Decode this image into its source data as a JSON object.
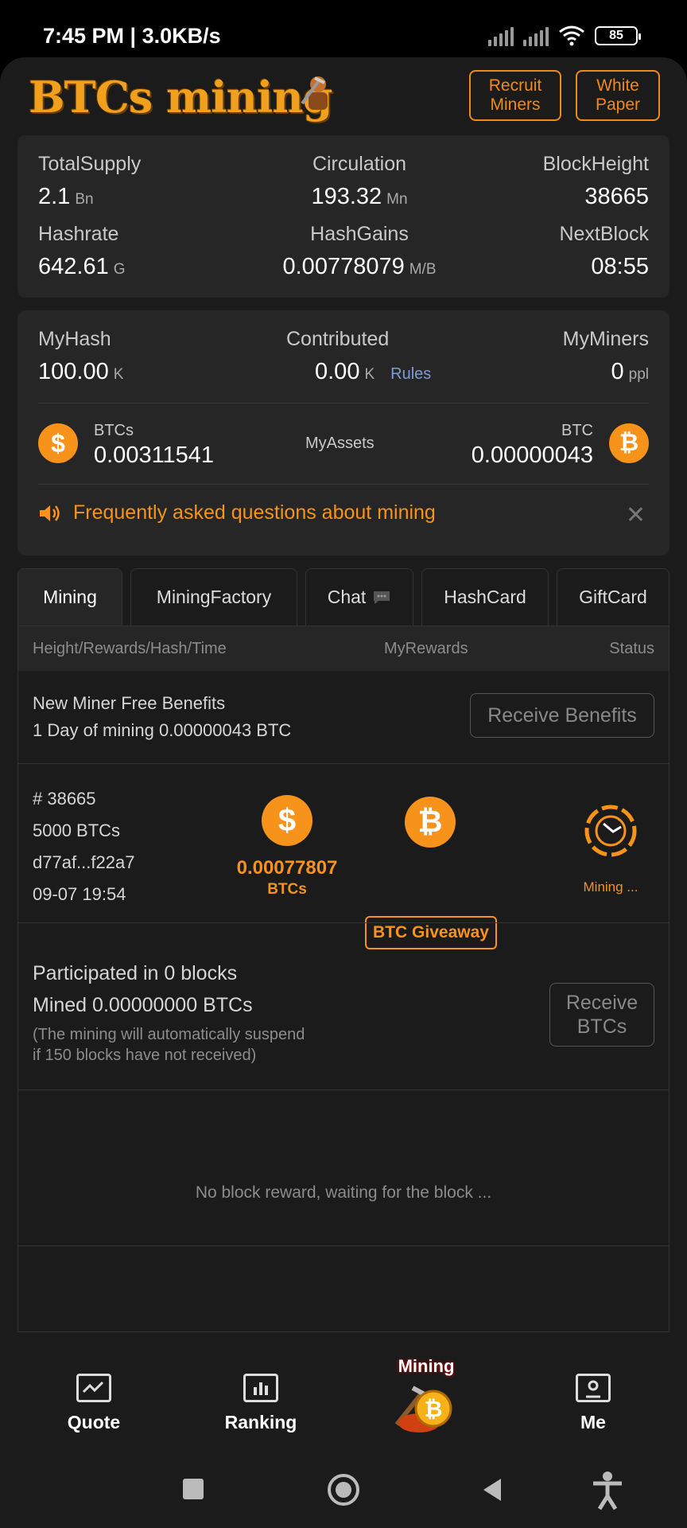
{
  "status": {
    "time": "7:45 PM | 3.0KB/s",
    "battery": "85"
  },
  "header": {
    "logo": "BTCs mining",
    "recruit": "Recruit Miners",
    "paper": "White Paper"
  },
  "stats": {
    "total_supply_label": "TotalSupply",
    "total_supply": "2.1",
    "total_supply_unit": "Bn",
    "circulation_label": "Circulation",
    "circulation": "193.32",
    "circulation_unit": "Mn",
    "block_height_label": "BlockHeight",
    "block_height": "38665",
    "hashrate_label": "Hashrate",
    "hashrate": "642.61",
    "hashrate_unit": "G",
    "hash_gains_label": "HashGains",
    "hash_gains": "0.00778079",
    "hash_gains_unit": "M/B",
    "next_block_label": "NextBlock",
    "next_block": "08:55"
  },
  "mine": {
    "myhash_label": "MyHash",
    "myhash": "100.00",
    "myhash_unit": "K",
    "contributed_label": "Contributed",
    "contributed": "0.00",
    "contributed_unit": "K",
    "rules": "Rules",
    "myminers_label": "MyMiners",
    "myminers": "0",
    "myminers_unit": "ppl",
    "btcs_label": "BTCs",
    "btcs_value": "0.00311541",
    "assets_label": "MyAssets",
    "btc_label": "BTC",
    "btc_value": "0.00000043",
    "faq": "Frequently asked questions about mining"
  },
  "tabs": [
    "Mining",
    "MiningFactory",
    "Chat",
    "HashCard",
    "GiftCard"
  ],
  "table": {
    "col1": "Height/Rewards/Hash/Time",
    "col2": "MyRewards",
    "col3": "Status",
    "benefit_title": "New Miner Free Benefits",
    "benefit_desc": "1 Day of mining 0.00000043 BTC",
    "benefit_btn": "Receive Benefits",
    "block_no": "# 38665",
    "block_reward": "5000 BTCs",
    "block_hash": "d77af...f22a7",
    "block_time": "09-07 19:54",
    "my_reward": "0.00077807",
    "my_reward_unit": "BTCs",
    "giveaway": "BTC Giveaway",
    "status": "Mining ...",
    "participated": "Participated in 0 blocks",
    "mined": "Mined 0.00000000 BTCs",
    "note1": "(The mining will automatically suspend",
    "note2": "if 150 blocks have not received)",
    "receive_btn": "Receive BTCs",
    "empty": "No block reward, waiting for the block ..."
  },
  "nav": {
    "quote": "Quote",
    "ranking": "Ranking",
    "mining": "Mining",
    "me": "Me"
  },
  "colors": {
    "accent": "#f7931a",
    "bg": "#1b1b1b",
    "card": "#262626"
  }
}
